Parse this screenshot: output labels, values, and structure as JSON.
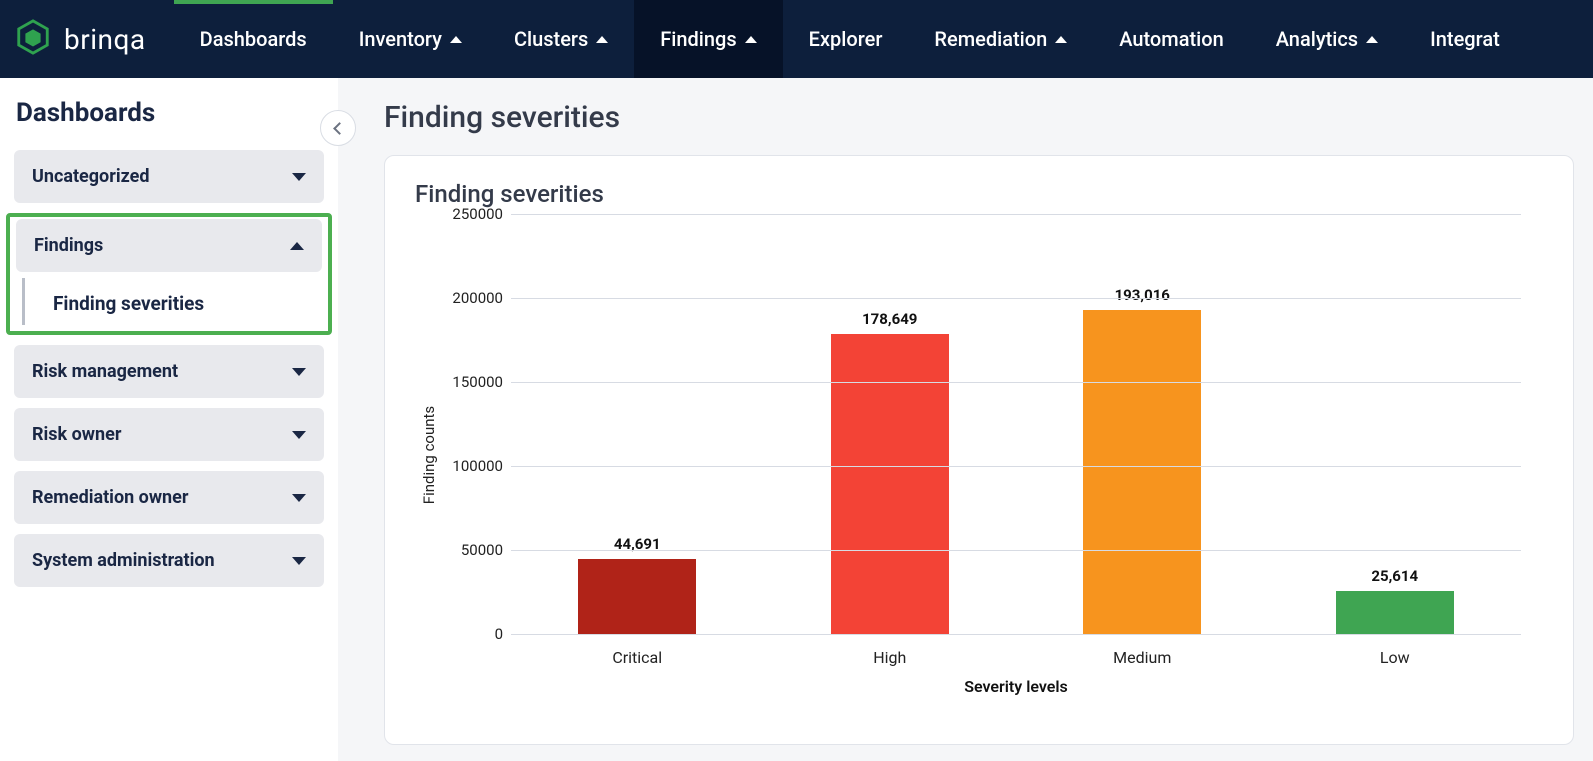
{
  "brand": "brinqa",
  "nav": {
    "items": [
      {
        "label": "Dashboards",
        "has_menu": false,
        "active": false,
        "top_accent": true
      },
      {
        "label": "Inventory",
        "has_menu": true,
        "active": false
      },
      {
        "label": "Clusters",
        "has_menu": true,
        "active": false
      },
      {
        "label": "Findings",
        "has_menu": true,
        "active": true
      },
      {
        "label": "Explorer",
        "has_menu": false,
        "active": false
      },
      {
        "label": "Remediation",
        "has_menu": true,
        "active": false
      },
      {
        "label": "Automation",
        "has_menu": false,
        "active": false
      },
      {
        "label": "Analytics",
        "has_menu": true,
        "active": false
      },
      {
        "label": "Integrat",
        "has_menu": false,
        "active": false
      }
    ]
  },
  "sidebar": {
    "title": "Dashboards",
    "groups": [
      {
        "label": "Uncategorized",
        "expanded": false,
        "highlighted": false
      },
      {
        "label": "Findings",
        "expanded": true,
        "highlighted": true,
        "children": [
          {
            "label": "Finding severities"
          }
        ]
      },
      {
        "label": "Risk management",
        "expanded": false
      },
      {
        "label": "Risk owner",
        "expanded": false
      },
      {
        "label": "Remediation owner",
        "expanded": false
      },
      {
        "label": "System administration",
        "expanded": false
      }
    ]
  },
  "page": {
    "title": "Finding severities",
    "card_title": "Finding severities"
  },
  "chart_data": {
    "type": "bar",
    "title": "Finding severities",
    "xlabel": "Severity levels",
    "ylabel": "Finding counts",
    "ylim": [
      0,
      250000
    ],
    "yticks": [
      0,
      50000,
      100000,
      150000,
      200000,
      250000
    ],
    "categories": [
      "Critical",
      "High",
      "Medium",
      "Low"
    ],
    "values": [
      44691,
      178649,
      193016,
      25614
    ],
    "value_labels": [
      "44,691",
      "178,649",
      "193,016",
      "25,614"
    ],
    "colors": [
      "#b02318",
      "#f34336",
      "#f7941e",
      "#3fa552"
    ]
  }
}
